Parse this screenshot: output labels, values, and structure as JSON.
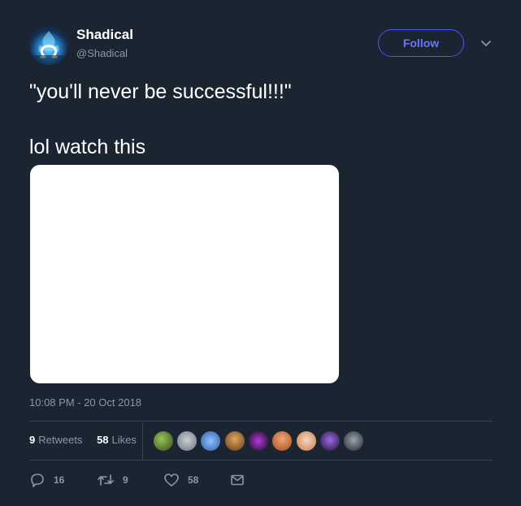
{
  "user": {
    "display_name": "Shadical",
    "handle": "@Shadical"
  },
  "follow_label": "Follow",
  "tweet": {
    "text": "\"you'll never be successful!!!\"\n\nlol watch this"
  },
  "timestamp": "10:08 PM - 20 Oct 2018",
  "stats": {
    "retweets_count": "9",
    "retweets_label": "Retweets",
    "likes_count": "58",
    "likes_label": "Likes"
  },
  "actions": {
    "replies": "16",
    "retweets": "9",
    "likes": "58"
  },
  "colors": {
    "background": "#1b2532",
    "accent": "#4a54ff",
    "muted": "#8899a6"
  },
  "likers_avatars": [
    "avatar-1",
    "avatar-2",
    "avatar-3",
    "avatar-4",
    "avatar-5",
    "avatar-6",
    "avatar-7",
    "avatar-8",
    "avatar-9"
  ]
}
